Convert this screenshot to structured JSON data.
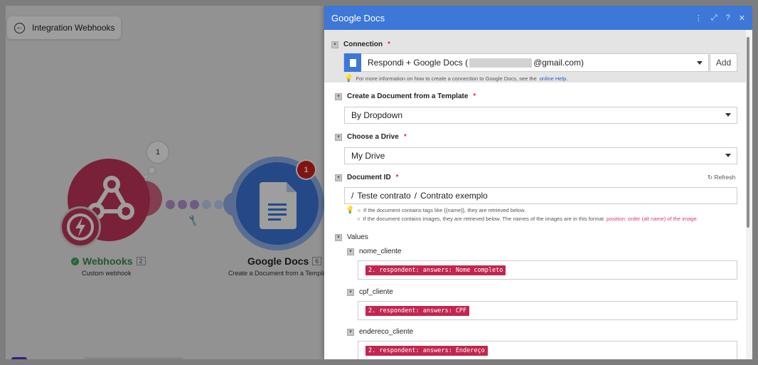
{
  "canvas": {
    "back_button_label": "Integration Webhooks",
    "bubble_count": "1",
    "webhooks_node": {
      "name": "Webhooks",
      "id": "2",
      "subtitle": "Custom webhook"
    },
    "gdocs_node": {
      "name": "Google Docs",
      "id": "6",
      "subtitle": "Create a Document from a Templat",
      "badge": "1"
    }
  },
  "panel": {
    "title": "Google Docs",
    "header_icons": [
      "more-vertical-icon",
      "expand-icon",
      "help-icon",
      "close-icon"
    ],
    "connection": {
      "label": "Connection",
      "value_prefix": "Respondi + Google Docs (",
      "value_suffix": "@gmail.com)",
      "add_label": "Add",
      "hint_text": "For more information on how to create a connection to Google Docs, see the",
      "hint_link": "online Help."
    },
    "template": {
      "label": "Create a Document from a Template",
      "value": "By Dropdown"
    },
    "drive": {
      "label": "Choose a Drive",
      "value": "My Drive"
    },
    "document": {
      "label": "Document ID",
      "refresh_label": "Refresh",
      "path_part1": "Teste contrato",
      "path_part2": "Contrato exemplo",
      "hint1": "If the document contains tags like {{name}}, they are retrieved below.",
      "hint2": "If the document contains images, they are retrieved below. The names of the images are in this format",
      "hint2_format": "position: order (alt name) of the image."
    },
    "values": {
      "label": "Values",
      "items": [
        {
          "name": "nome_cliente",
          "pill": "2. respondent: answers: Nome completo"
        },
        {
          "name": "cpf_cliente",
          "pill": "2. respondent: answers: CPF"
        },
        {
          "name": "endereco_cliente",
          "pill": "2. respondent: answers: Endereço"
        }
      ]
    }
  },
  "colors": {
    "panel_header": "#3d77d8",
    "webhook_node": "#c4365c",
    "pill": "#c22650"
  }
}
